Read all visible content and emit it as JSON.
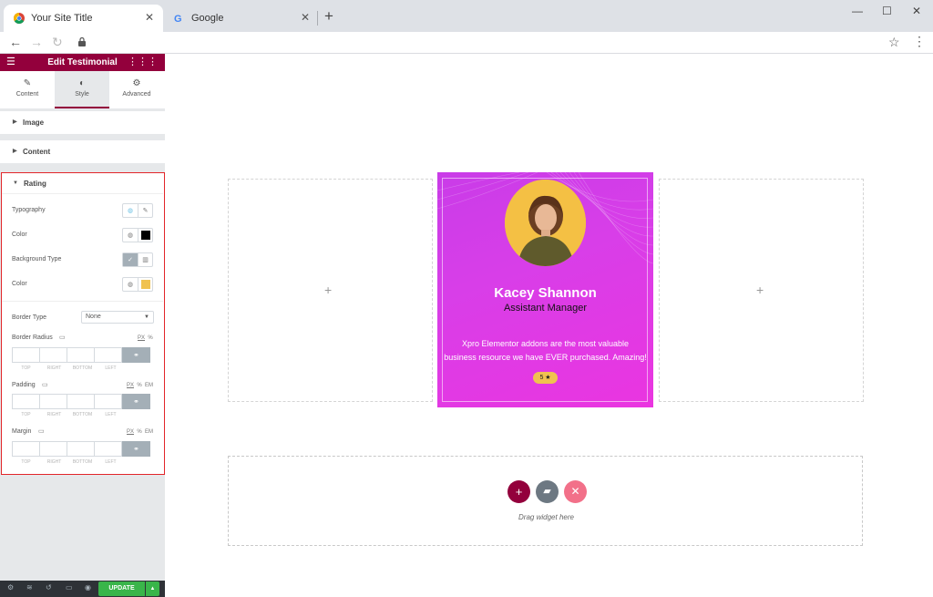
{
  "browser": {
    "tabs": [
      {
        "title": "Your Site Title",
        "active": true
      },
      {
        "title": "Google",
        "active": false
      }
    ],
    "new_tab": "+",
    "window_controls": {
      "minimize": "—",
      "maximize": "☐",
      "close": "✕"
    }
  },
  "panel": {
    "header_title": "Edit Testimonial",
    "tabs": [
      {
        "label": "Content",
        "icon": "pencil-icon"
      },
      {
        "label": "Style",
        "icon": "contrast-icon"
      },
      {
        "label": "Advanced",
        "icon": "gear-icon"
      }
    ],
    "sections": [
      {
        "label": "Image"
      },
      {
        "label": "Content"
      }
    ],
    "rating": {
      "title": "Rating",
      "typography": "Typography",
      "color": "Color",
      "background_type": "Background Type",
      "bg_color": "Color",
      "border_type": "Border Type",
      "border_type_value": "None",
      "border_radius": "Border Radius",
      "padding": "Padding",
      "margin": "Margin",
      "units_px": "PX",
      "units_pct": "%",
      "units_em": "EM",
      "dim_labels": [
        "TOP",
        "RIGHT",
        "BOTTOM",
        "LEFT"
      ],
      "color_swatch": "#000000",
      "bg_color_swatch": "#f0c250"
    },
    "footer": {
      "update": "UPDATE"
    }
  },
  "canvas": {
    "testimonial": {
      "name": "Kacey Shannon",
      "role": "Assistant Manager",
      "text_line1": "Xpro Elementor addons are the most valuable",
      "text_line2": "business resource we have EVER purchased. Amazing!",
      "rating": "5 ★"
    },
    "drop_text": "Drag widget here"
  },
  "colors": {
    "accent": "#93003c",
    "update_green": "#39b54a",
    "rating_highlight": "#e2262a"
  }
}
